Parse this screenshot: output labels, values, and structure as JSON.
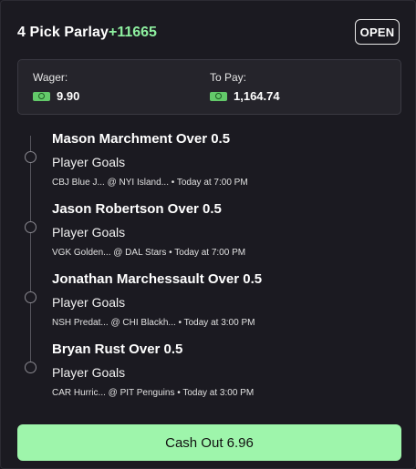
{
  "header": {
    "title": "4 Pick Parlay",
    "odds": "+11665",
    "status": "OPEN"
  },
  "wager": {
    "wager_label": "Wager:",
    "wager_value": "9.90",
    "to_pay_label": "To Pay:",
    "to_pay_value": "1,164.74",
    "icon": "cash-icon"
  },
  "legs": [
    {
      "title": "Mason Marchment Over 0.5",
      "market": "Player Goals",
      "meta": "CBJ Blue J... @ NYI Island... • Today at 7:00 PM"
    },
    {
      "title": "Jason Robertson Over 0.5",
      "market": "Player Goals",
      "meta": "VGK Golden... @ DAL Stars • Today at 7:00 PM"
    },
    {
      "title": "Jonathan Marchessault Over 0.5",
      "market": "Player Goals",
      "meta": "NSH Predat... @ CHI Blackh... • Today at 3:00 PM"
    },
    {
      "title": "Bryan Rust Over 0.5",
      "market": "Player Goals",
      "meta": "CAR Hurric... @ PIT Penguins • Today at 3:00 PM"
    }
  ],
  "cashout": {
    "label": "Cash Out 6.96"
  },
  "colors": {
    "accent": "#8ef0a0",
    "button": "#9ef5ab",
    "background": "#1b1a21"
  }
}
